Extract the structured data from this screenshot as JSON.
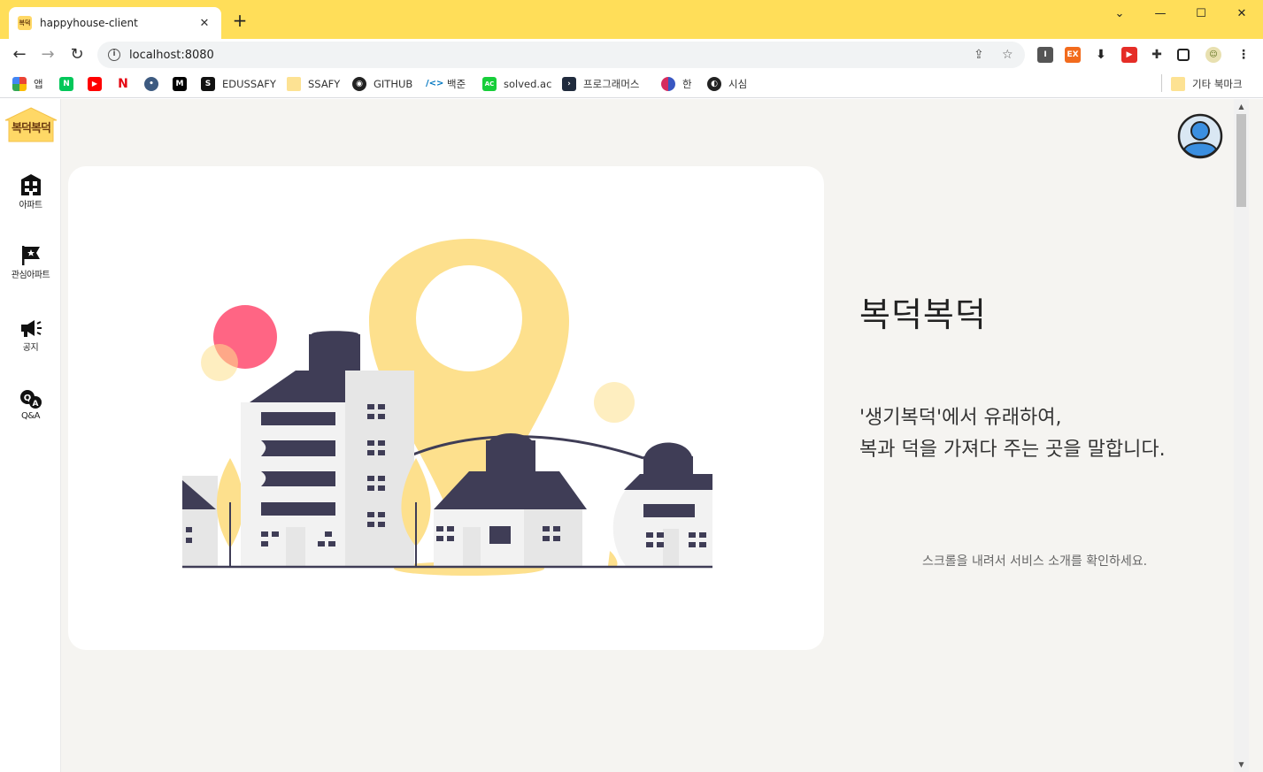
{
  "browser": {
    "tab_title": "happyhouse-client",
    "favicon_text": "복덕",
    "url": "localhost:8080",
    "bookmarks": [
      {
        "label": "앱",
        "icon": "apps-grid-icon"
      },
      {
        "label": "",
        "icon": "naver-icon"
      },
      {
        "label": "",
        "icon": "youtube-icon"
      },
      {
        "label": "",
        "icon": "netflix-icon"
      },
      {
        "label": "",
        "icon": "site-icon"
      },
      {
        "label": "",
        "icon": "medium-icon"
      },
      {
        "label": "EDUSSAFY",
        "icon": "edussafy-icon"
      },
      {
        "label": "SSAFY",
        "icon": "folder-icon"
      },
      {
        "label": "GITHUB",
        "icon": "github-icon"
      },
      {
        "label": "백준",
        "icon": "baekjoon-icon"
      },
      {
        "label": "solved.ac",
        "icon": "solved-icon"
      },
      {
        "label": "프로그래머스",
        "icon": "programmers-icon"
      },
      {
        "label": "한",
        "icon": "han-icon"
      },
      {
        "label": "시심",
        "icon": "globe-icon"
      }
    ],
    "other_bookmarks": "기타 북마크",
    "accent_color": "#ffde59"
  },
  "sidebar": {
    "logo_text": "복덕복덕",
    "items": [
      {
        "label": "아파트",
        "icon": "building-icon"
      },
      {
        "label": "관심아파트",
        "icon": "star-flag-icon"
      },
      {
        "label": "공지",
        "icon": "megaphone-icon"
      },
      {
        "label": "Q&A",
        "icon": "qna-icon"
      }
    ]
  },
  "hero": {
    "title": "복덕복덕",
    "desc_line1": "'생기복덕'에서 유래하여,",
    "desc_line2": "복과 덕을 가져다 주는 곳을 말합니다.",
    "scroll_hint": "스크롤을 내려서 서비스 소개를 확인하세요."
  }
}
